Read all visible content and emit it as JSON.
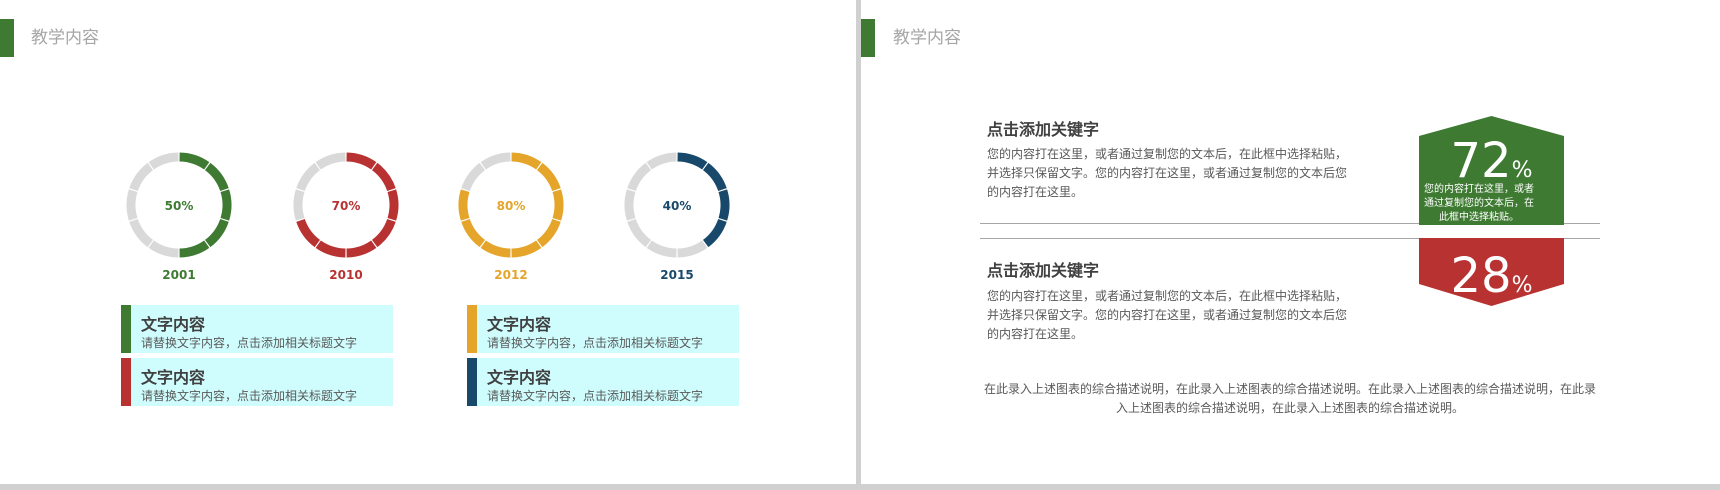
{
  "left_slide": {
    "title": "教学内容",
    "accent_color": "#3e7a32",
    "rings": [
      {
        "label": "50%",
        "year": "2001",
        "value": 50,
        "color": "#3e7a32"
      },
      {
        "label": "70%",
        "year": "2010",
        "value": 70,
        "color": "#b83232"
      },
      {
        "label": "80%",
        "year": "2012",
        "value": 80,
        "color": "#e4a52a"
      },
      {
        "label": "40%",
        "year": "2015",
        "value": 40,
        "color": "#18496a"
      }
    ],
    "ring_track_color": "#d9d9d9",
    "cards": [
      {
        "title": "文字内容",
        "text": "请替换文字内容，点击添加相关标题文字",
        "color": "#3e7a32"
      },
      {
        "title": "文字内容",
        "text": "请替换文字内容，点击添加相关标题文字",
        "color": "#b83232"
      },
      {
        "title": "文字内容",
        "text": "请替换文字内容，点击添加相关标题文字",
        "color": "#e4a52a"
      },
      {
        "title": "文字内容",
        "text": "请替换文字内容，点击添加相关标题文字",
        "color": "#18496a"
      }
    ]
  },
  "right_slide": {
    "title": "教学内容",
    "accent_color": "#3e7a32",
    "blocks": [
      {
        "heading": "点击添加关键字",
        "body": "您的内容打在这里，或者通过复制您的文本后，在此框中选择粘贴，并选择只保留文字。您的内容打在这里，或者通过复制您的文本后您的内容打在这里。"
      },
      {
        "heading": "点击添加关键字",
        "body": "您的内容打在这里，或者通过复制您的文本后，在此框中选择粘贴，并选择只保留文字。您的内容打在这里，或者通过复制您的文本后您的内容打在这里。"
      }
    ],
    "badges": [
      {
        "number": "72",
        "unit": "%",
        "value": 72,
        "color": "#3e7a32",
        "description": "您的内容打在这里，或者通过复制您的文本后，在此框中选择粘贴。"
      },
      {
        "number": "28",
        "unit": "%",
        "value": 28,
        "color": "#b83232"
      }
    ],
    "summary": "在此录入上述图表的综合描述说明，在此录入上述图表的综合描述说明。在此录入上述图表的综合描述说明，在此录入上述图表的综合描述说明，在此录入上述图表的综合描述说明。"
  }
}
